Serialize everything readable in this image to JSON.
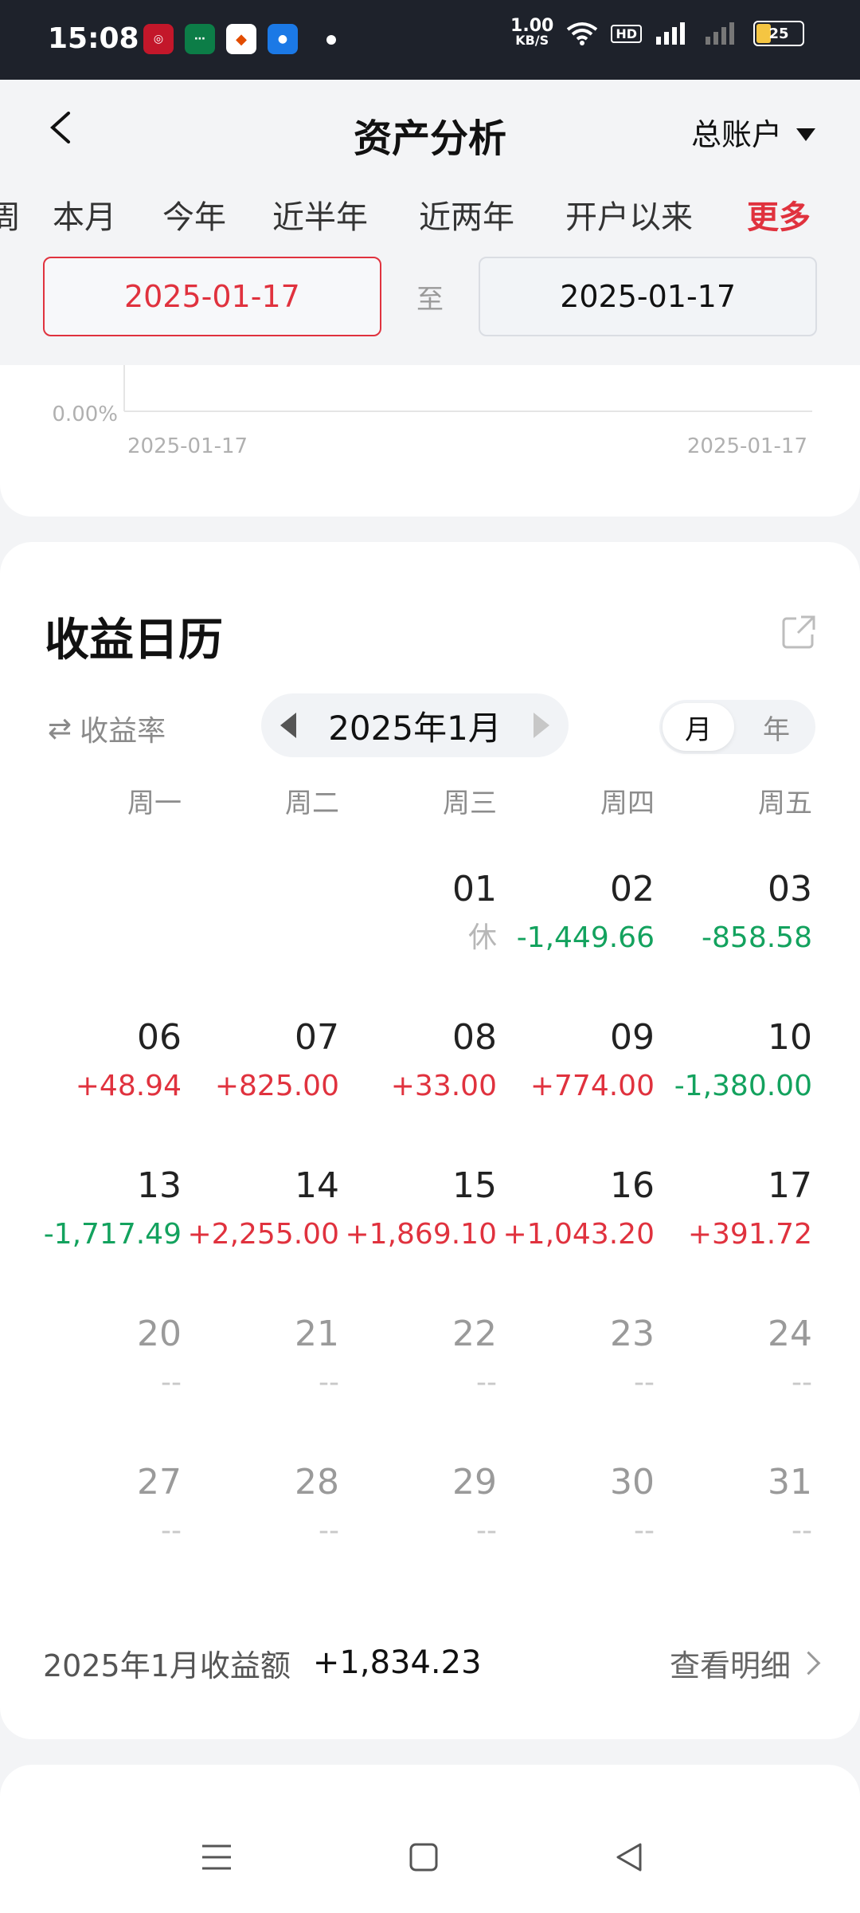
{
  "status_bar": {
    "time": "15:08",
    "speed_value": "1.00",
    "speed_unit": "KB/S",
    "battery": "25",
    "hd": "HD"
  },
  "header": {
    "title": "资产分析",
    "account": "总账户"
  },
  "tabs": {
    "partial": "周",
    "items": [
      "本月",
      "今年",
      "近半年",
      "近两年",
      "开户以来",
      "更多"
    ]
  },
  "date_range": {
    "start": "2025-01-17",
    "separator": "至",
    "end": "2025-01-17"
  },
  "chart_data": {
    "type": "line",
    "x": [
      "2025-01-17"
    ],
    "series": [
      {
        "values": [
          0.0
        ]
      }
    ],
    "y_tick_label": "0.00%",
    "x_tick_labels": [
      "2025-01-17",
      "2025-01-17"
    ]
  },
  "calendar": {
    "title": "收益日历",
    "rate_toggle": "收益率",
    "month_label": "2025年1月",
    "view_options": [
      "月",
      "年"
    ],
    "weekdays": [
      "周一",
      "周二",
      "周三",
      "周四",
      "周五"
    ],
    "rows": [
      [
        null,
        null,
        {
          "day": "01",
          "value": "休",
          "kind": "rest"
        },
        {
          "day": "02",
          "value": "-1,449.66",
          "kind": "neg"
        },
        {
          "day": "03",
          "value": "-858.58",
          "kind": "neg"
        }
      ],
      [
        {
          "day": "06",
          "value": "+48.94",
          "kind": "pos"
        },
        {
          "day": "07",
          "value": "+825.00",
          "kind": "pos"
        },
        {
          "day": "08",
          "value": "+33.00",
          "kind": "pos"
        },
        {
          "day": "09",
          "value": "+774.00",
          "kind": "pos"
        },
        {
          "day": "10",
          "value": "-1,380.00",
          "kind": "neg"
        }
      ],
      [
        {
          "day": "13",
          "value": "-1,717.49",
          "kind": "neg"
        },
        {
          "day": "14",
          "value": "+2,255.00",
          "kind": "pos"
        },
        {
          "day": "15",
          "value": "+1,869.10",
          "kind": "pos"
        },
        {
          "day": "16",
          "value": "+1,043.20",
          "kind": "pos"
        },
        {
          "day": "17",
          "value": "+391.72",
          "kind": "pos"
        }
      ],
      [
        {
          "day": "20",
          "value": "--",
          "kind": "none"
        },
        {
          "day": "21",
          "value": "--",
          "kind": "none"
        },
        {
          "day": "22",
          "value": "--",
          "kind": "none"
        },
        {
          "day": "23",
          "value": "--",
          "kind": "none"
        },
        {
          "day": "24",
          "value": "--",
          "kind": "none"
        }
      ],
      [
        {
          "day": "27",
          "value": "--",
          "kind": "none"
        },
        {
          "day": "28",
          "value": "--",
          "kind": "none"
        },
        {
          "day": "29",
          "value": "--",
          "kind": "none"
        },
        {
          "day": "30",
          "value": "--",
          "kind": "none"
        },
        {
          "day": "31",
          "value": "--",
          "kind": "none"
        }
      ]
    ],
    "summary_label": "2025年1月收益额",
    "summary_amount": "+1,834.23",
    "detail_link": "查看明细"
  },
  "colors": {
    "accent_red": "#E0323E",
    "gain_green": "#13A25E"
  }
}
